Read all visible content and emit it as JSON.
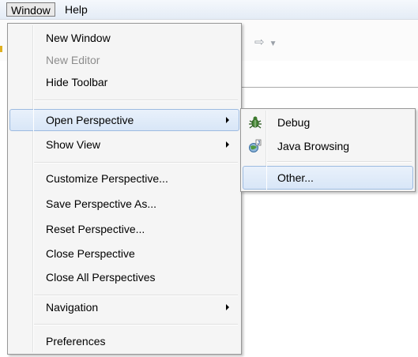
{
  "menubar": {
    "items": [
      {
        "label": "Window"
      },
      {
        "label": "Help"
      }
    ]
  },
  "window_menu": {
    "items": [
      {
        "label": "New Window",
        "enabled": true
      },
      {
        "label": "New Editor",
        "enabled": false
      },
      {
        "label": "Hide Toolbar",
        "enabled": true
      },
      {
        "label": "Open Perspective",
        "enabled": true,
        "submenu": true,
        "highlighted": true
      },
      {
        "label": "Show View",
        "enabled": true,
        "submenu": true
      },
      {
        "label": "Customize Perspective...",
        "enabled": true
      },
      {
        "label": "Save Perspective As...",
        "enabled": true
      },
      {
        "label": "Reset Perspective...",
        "enabled": true
      },
      {
        "label": "Close Perspective",
        "enabled": true
      },
      {
        "label": "Close All Perspectives",
        "enabled": true
      },
      {
        "label": "Navigation",
        "enabled": true,
        "submenu": true
      },
      {
        "label": "Preferences",
        "enabled": true
      }
    ]
  },
  "perspective_submenu": {
    "items": [
      {
        "label": "Debug",
        "icon": "debug-bug-icon"
      },
      {
        "label": "Java Browsing",
        "icon": "java-browsing-icon"
      },
      {
        "label": "Other...",
        "highlighted": true
      }
    ]
  },
  "colors": {
    "highlight_border": "#9dbbe0",
    "highlight_fill": "#d8e6f7",
    "disabled_text": "#8d8d8d"
  }
}
